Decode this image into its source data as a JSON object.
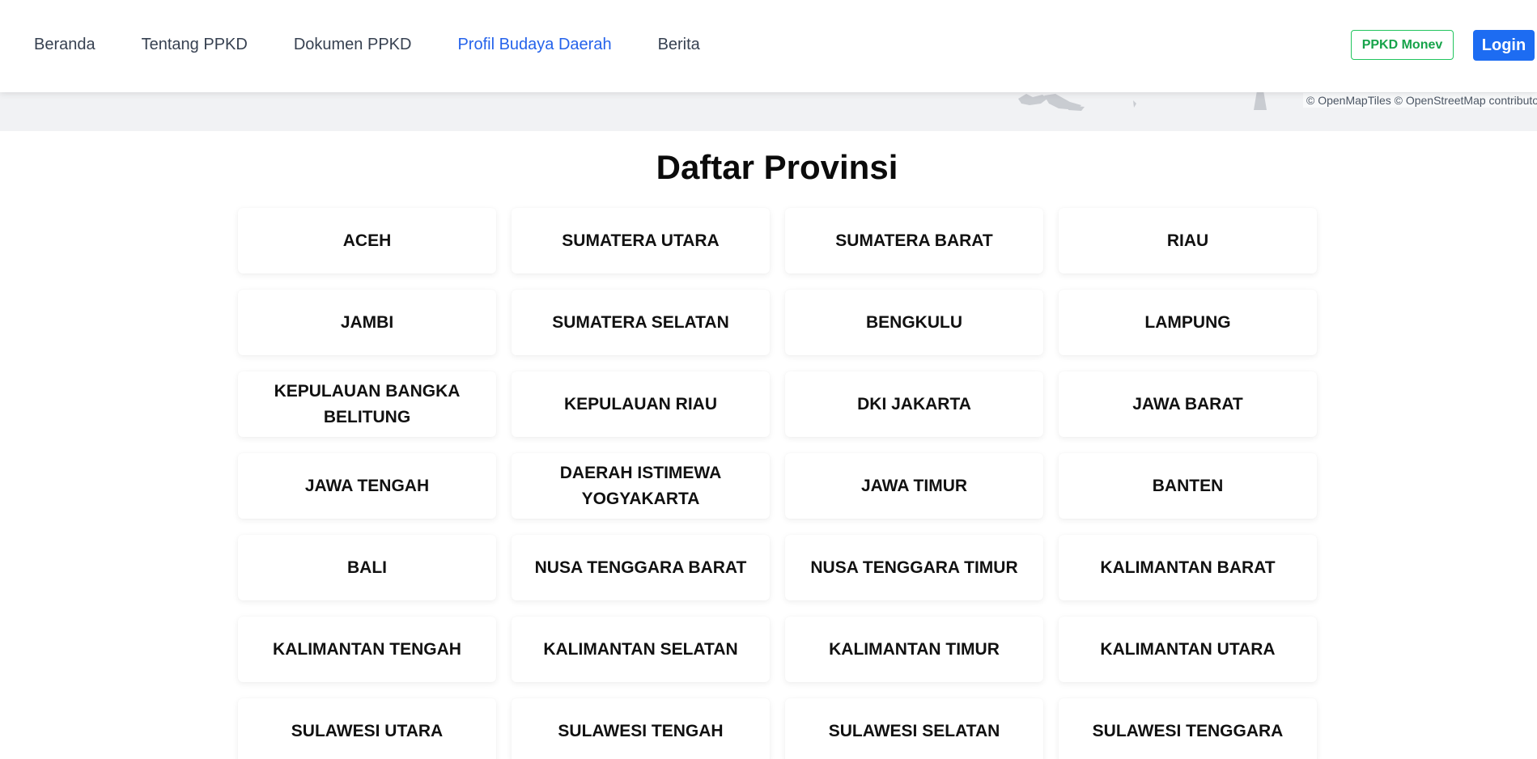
{
  "nav": {
    "links": [
      {
        "label": "Beranda",
        "active": false
      },
      {
        "label": "Tentang PPKD",
        "active": false
      },
      {
        "label": "Dokumen PPKD",
        "active": false
      },
      {
        "label": "Profil Budaya Daerah",
        "active": true
      },
      {
        "label": "Berita",
        "active": false
      }
    ],
    "monev_label": "PPKD Monev",
    "login_label": "Login"
  },
  "map": {
    "attribution": "© OpenMapTiles © OpenStreetMap contributors"
  },
  "section": {
    "title": "Daftar Provinsi"
  },
  "provinces": [
    "ACEH",
    "SUMATERA UTARA",
    "SUMATERA BARAT",
    "RIAU",
    "JAMBI",
    "SUMATERA SELATAN",
    "BENGKULU",
    "LAMPUNG",
    "KEPULAUAN BANGKA BELITUNG",
    "KEPULAUAN RIAU",
    "DKI JAKARTA",
    "JAWA BARAT",
    "JAWA TENGAH",
    "DAERAH ISTIMEWA YOGYAKARTA",
    "JAWA TIMUR",
    "BANTEN",
    "BALI",
    "NUSA TENGGARA BARAT",
    "NUSA TENGGARA TIMUR",
    "KALIMANTAN BARAT",
    "KALIMANTAN TENGAH",
    "KALIMANTAN SELATAN",
    "KALIMANTAN TIMUR",
    "KALIMANTAN UTARA",
    "SULAWESI UTARA",
    "SULAWESI TENGAH",
    "SULAWESI SELATAN",
    "SULAWESI TENGGARA"
  ],
  "colors": {
    "accent": "#2563eb",
    "login_bg": "#1d6cf2",
    "monev_green": "#16a34a",
    "map_bg": "#f1f2f4"
  }
}
